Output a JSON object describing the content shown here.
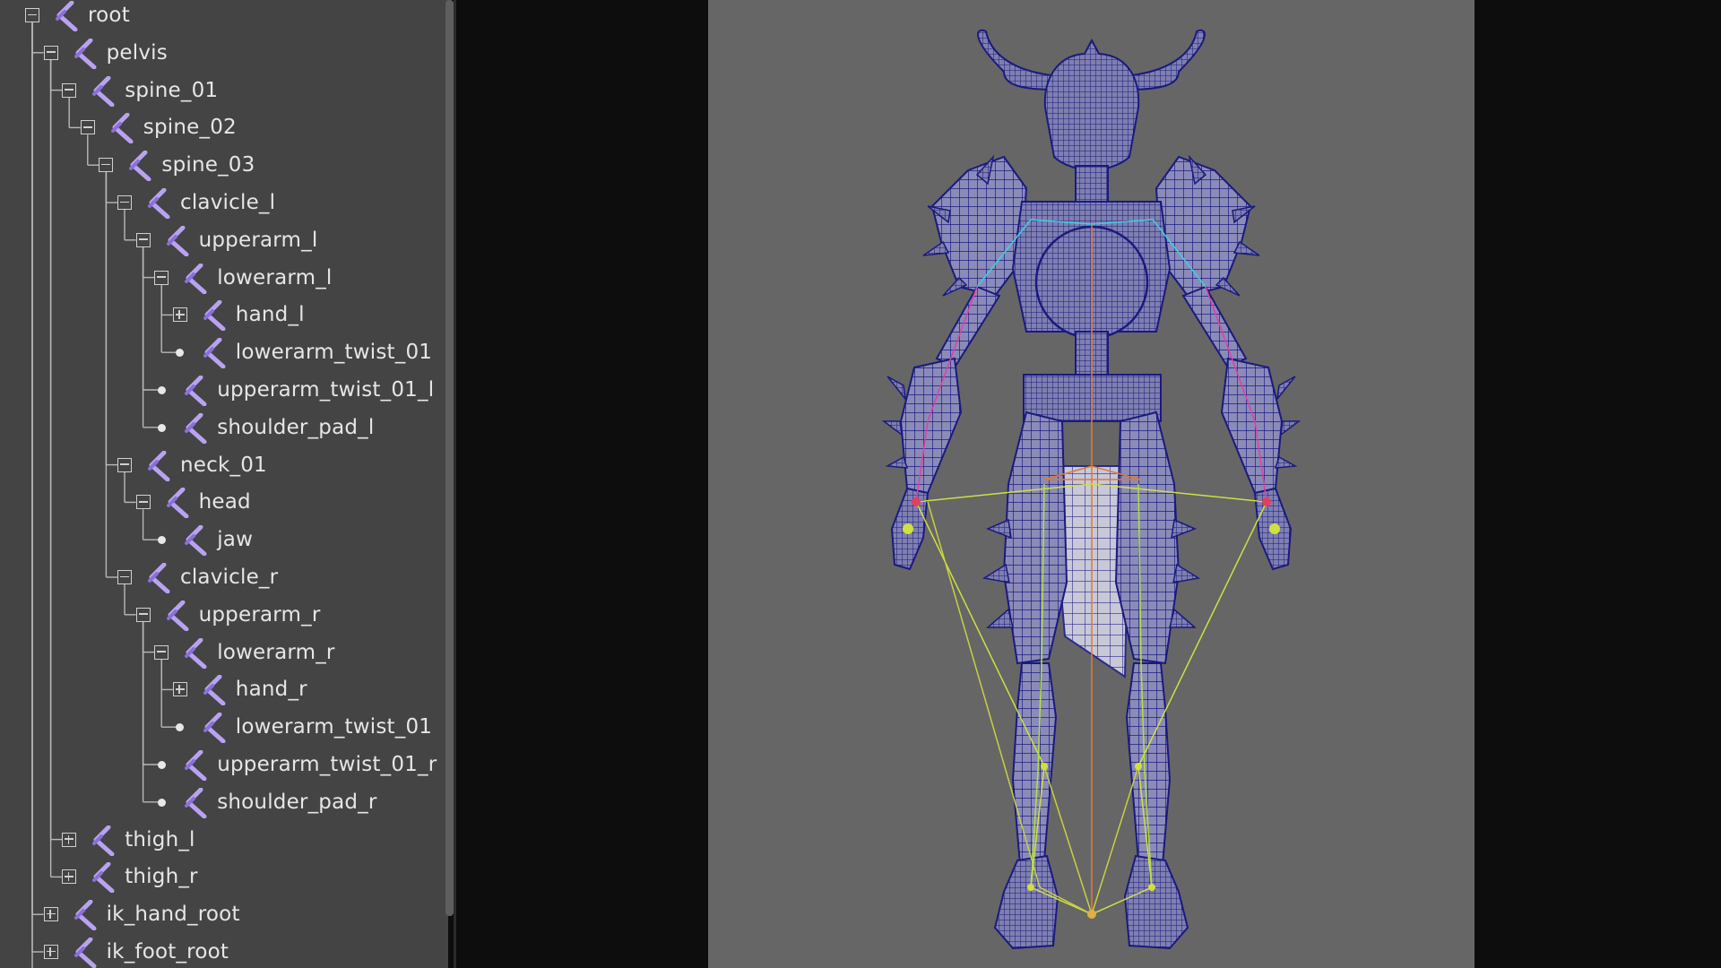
{
  "outliner": {
    "nodes": [
      {
        "label": "root",
        "expander": "minus"
      },
      {
        "label": "pelvis",
        "expander": "minus"
      },
      {
        "label": "spine_01",
        "expander": "minus"
      },
      {
        "label": "spine_02",
        "expander": "minus"
      },
      {
        "label": "spine_03",
        "expander": "minus"
      },
      {
        "label": "clavicle_l",
        "expander": "minus"
      },
      {
        "label": "upperarm_l",
        "expander": "minus"
      },
      {
        "label": "lowerarm_l",
        "expander": "minus"
      },
      {
        "label": "hand_l",
        "expander": "plus"
      },
      {
        "label": "lowerarm_twist_01",
        "expander": "none"
      },
      {
        "label": "upperarm_twist_01_l",
        "expander": "none"
      },
      {
        "label": "shoulder_pad_l",
        "expander": "none"
      },
      {
        "label": "neck_01",
        "expander": "minus"
      },
      {
        "label": "head",
        "expander": "minus"
      },
      {
        "label": "jaw",
        "expander": "none"
      },
      {
        "label": "clavicle_r",
        "expander": "minus"
      },
      {
        "label": "upperarm_r",
        "expander": "minus"
      },
      {
        "label": "lowerarm_r",
        "expander": "minus"
      },
      {
        "label": "hand_r",
        "expander": "plus"
      },
      {
        "label": "lowerarm_twist_01",
        "expander": "none"
      },
      {
        "label": "upperarm_twist_01_r",
        "expander": "none"
      },
      {
        "label": "shoulder_pad_r",
        "expander": "none"
      },
      {
        "label": "thigh_l",
        "expander": "plus"
      },
      {
        "label": "thigh_r",
        "expander": "plus"
      },
      {
        "label": "ik_hand_root",
        "expander": "plus"
      },
      {
        "label": "ik_foot_root",
        "expander": "plus"
      }
    ],
    "icon": "joint-icon"
  },
  "viewport": {
    "subject": "wireframe armored character with skeleton joints",
    "background_color": "#666666",
    "wire_color": "#1f1f8f",
    "bone_colors": [
      "#d0e040",
      "#e07a30",
      "#e040a0",
      "#40d0e0"
    ]
  }
}
